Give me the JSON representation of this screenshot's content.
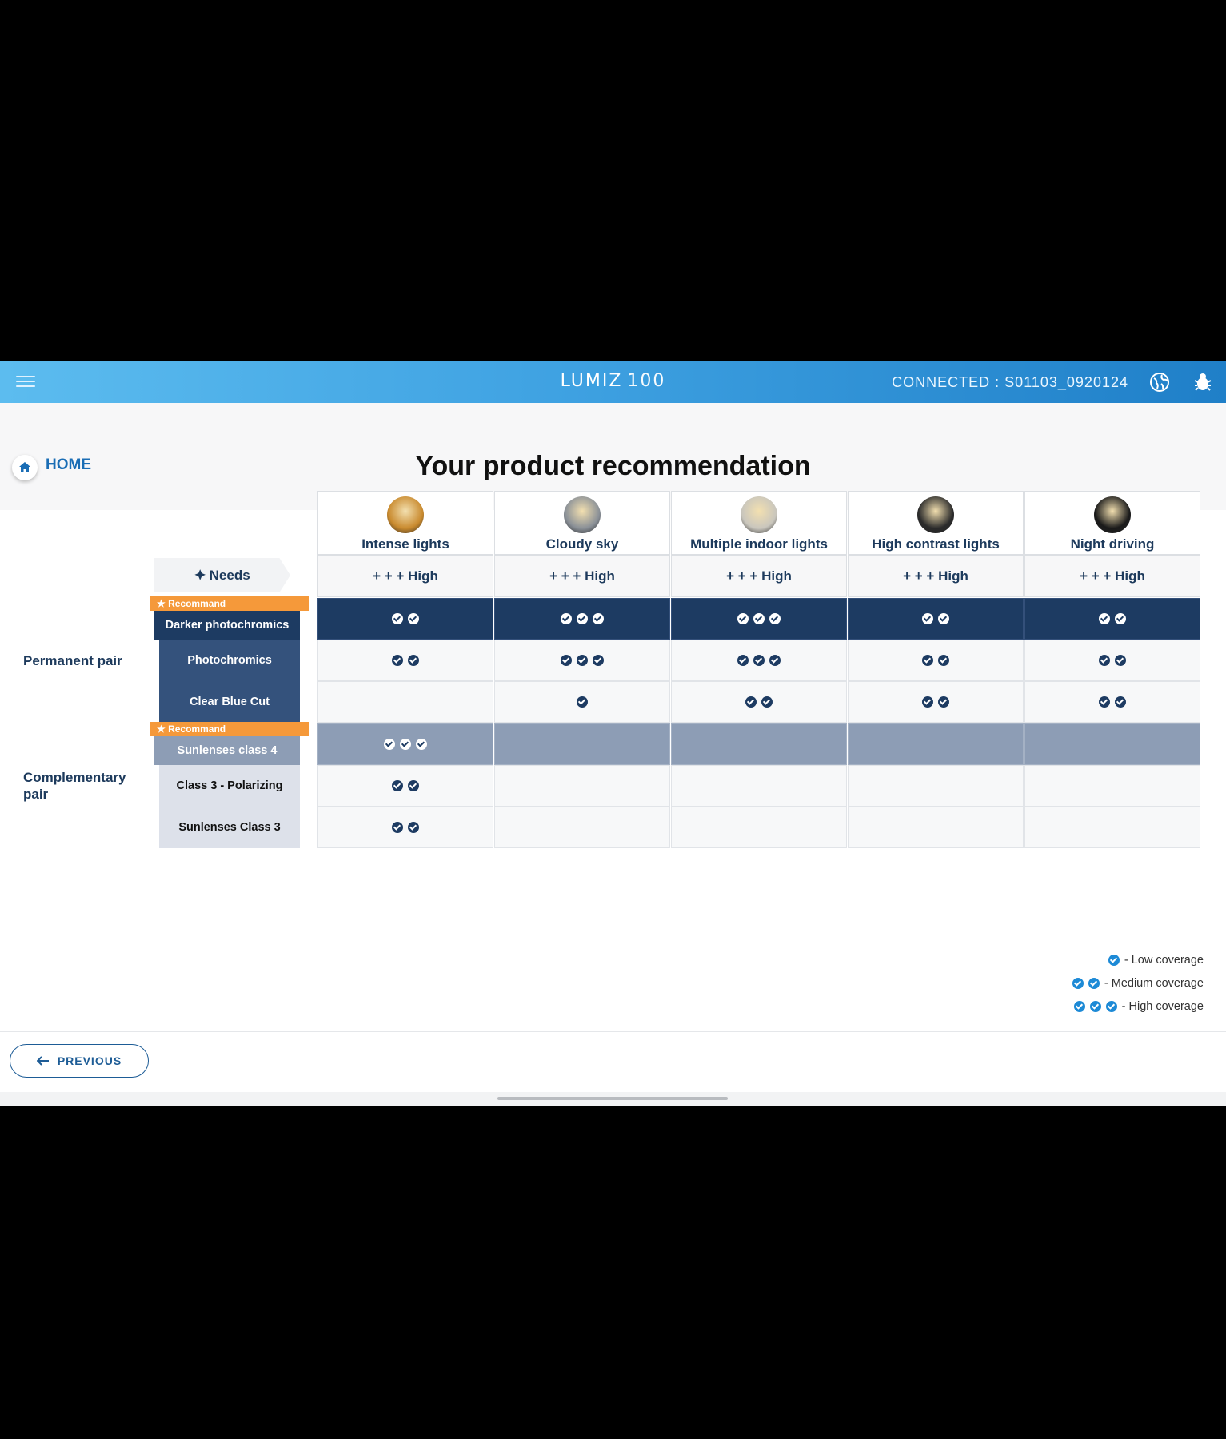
{
  "header": {
    "logo_text": "LUMIZ",
    "logo_number": "100",
    "connection": "CONNECTED : S01103_0920124"
  },
  "nav": {
    "home_label": "HOME"
  },
  "page": {
    "title": "Your product recommendation"
  },
  "columns": [
    {
      "label": "Intense lights",
      "need": "+ + + High",
      "thumb_color": "#c98a2e"
    },
    {
      "label": "Cloudy sky",
      "need": "+ + + High",
      "thumb_color": "#8a9097"
    },
    {
      "label": "Multiple indoor lights",
      "need": "+ + + High",
      "thumb_color": "#c9c6bd"
    },
    {
      "label": "High contrast lights",
      "need": "+ + + High",
      "thumb_color": "#2b2b2b"
    },
    {
      "label": "Night driving",
      "need": "+ + + High",
      "thumb_color": "#1a1a1a"
    }
  ],
  "needs_label": "Needs",
  "recommend_label": "★ Recommand",
  "groups": [
    {
      "label": "Permanent pair"
    },
    {
      "label": "Complementary pair"
    }
  ],
  "rows": [
    {
      "product": "Darker photochromics",
      "style": "dark",
      "recommended": true,
      "coverage": [
        2,
        3,
        3,
        2,
        2
      ]
    },
    {
      "product": "Photochromics",
      "style": "light",
      "recommended": false,
      "coverage": [
        2,
        3,
        3,
        2,
        2
      ]
    },
    {
      "product": "Clear Blue Cut",
      "style": "light",
      "recommended": false,
      "coverage": [
        0,
        1,
        2,
        2,
        2
      ]
    },
    {
      "product": "Sunlenses class 4",
      "style": "gray",
      "recommended": true,
      "coverage": [
        3,
        0,
        0,
        0,
        0
      ]
    },
    {
      "product": "Class 3 - Polarizing",
      "style": "light",
      "recommended": false,
      "coverage": [
        2,
        0,
        0,
        0,
        0
      ]
    },
    {
      "product": "Sunlenses Class 3",
      "style": "light",
      "recommended": false,
      "coverage": [
        2,
        0,
        0,
        0,
        0
      ]
    }
  ],
  "legend": [
    {
      "count": 1,
      "label": "- Low coverage"
    },
    {
      "count": 2,
      "label": "- Medium coverage"
    },
    {
      "count": 3,
      "label": "- High coverage"
    }
  ],
  "footer": {
    "previous_label": "PREVIOUS"
  },
  "colors": {
    "navy": "#1d3b62",
    "accent_orange": "#f5993a",
    "brand_blue": "#1d8ad6"
  }
}
